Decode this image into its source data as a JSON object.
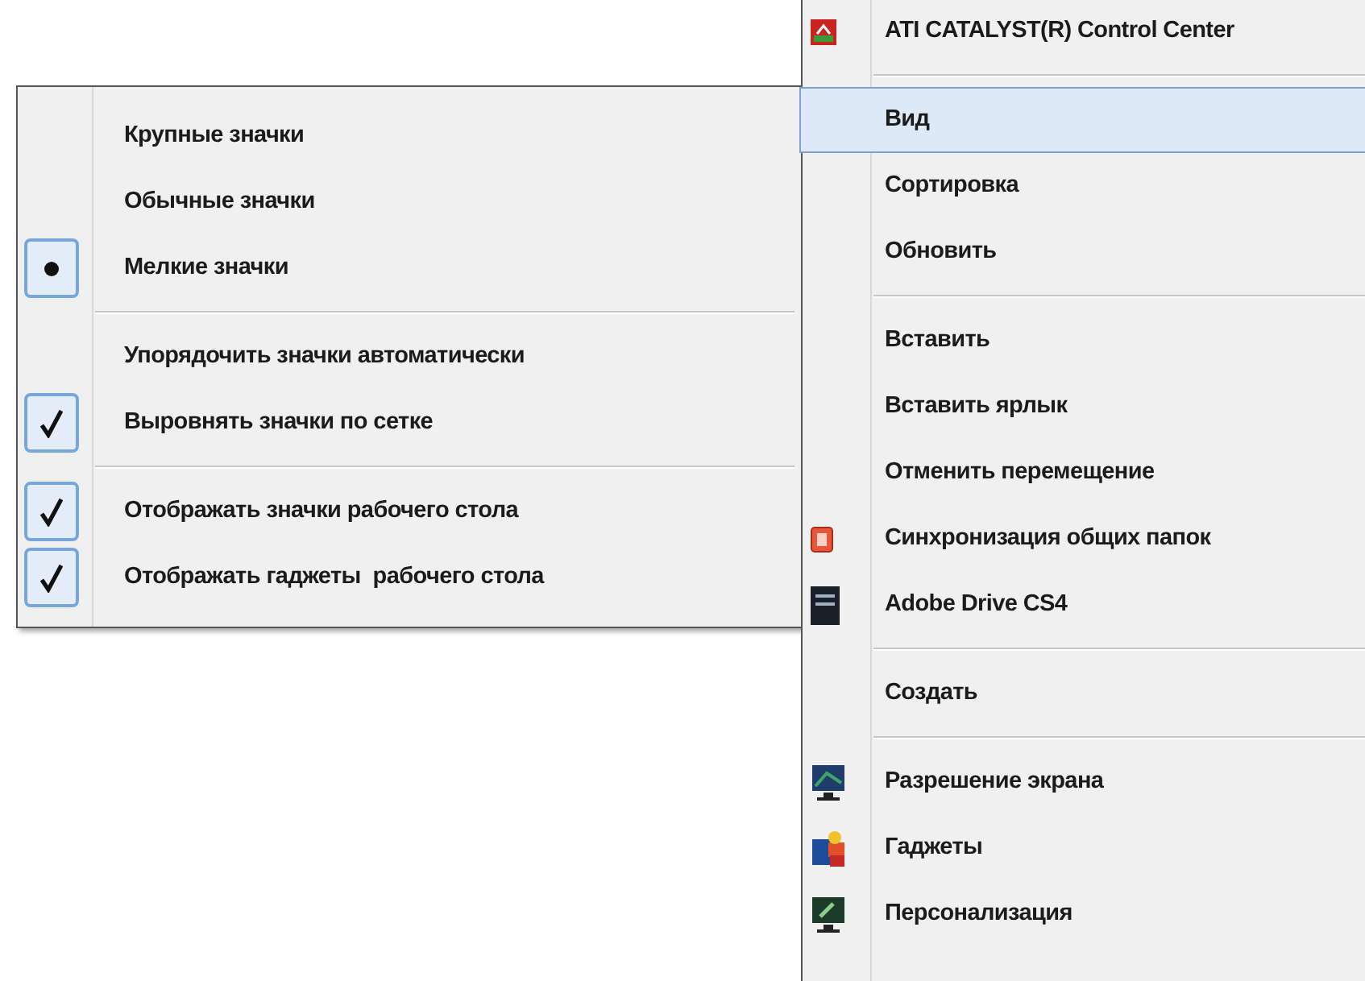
{
  "view_submenu": {
    "groups": [
      {
        "items": [
          {
            "kind": "radio",
            "label": "Крупные значки",
            "selected": false
          },
          {
            "kind": "radio",
            "label": "Обычные значки",
            "selected": false
          },
          {
            "kind": "radio",
            "label": "Мелкие значки",
            "selected": true
          }
        ]
      },
      {
        "items": [
          {
            "kind": "check",
            "label": "Упорядочить значки автоматически",
            "checked": false
          },
          {
            "kind": "check",
            "label": "Выровнять значки по сетке",
            "checked": true
          }
        ]
      },
      {
        "items": [
          {
            "kind": "check",
            "label": "Отображать значки рабочего стола",
            "checked": true
          },
          {
            "kind": "check",
            "label": "Отображать гаджеты  рабочего стола",
            "checked": true
          }
        ]
      }
    ]
  },
  "context_menu": {
    "groups": [
      {
        "items": [
          {
            "kind": "ati",
            "label": "ATI CATALYST(R) Control Center",
            "selected": false
          }
        ]
      },
      {
        "items": [
          {
            "label": "Вид",
            "selected": true
          },
          {
            "label": "Сортировка",
            "selected": false
          },
          {
            "label": "Обновить",
            "selected": false
          }
        ]
      },
      {
        "items": [
          {
            "label": "Вставить",
            "selected": false
          },
          {
            "label": "Вставить ярлык",
            "selected": false
          },
          {
            "label": "Отменить перемещение",
            "selected": false
          },
          {
            "kind": "sync",
            "label": "Синхронизация общих папок",
            "selected": false
          },
          {
            "kind": "drive",
            "label": "Adobe Drive CS4",
            "selected": false
          }
        ]
      },
      {
        "items": [
          {
            "label": "Создать",
            "selected": false
          }
        ]
      },
      {
        "items": [
          {
            "kind": "display",
            "label": "Разрешение экрана",
            "selected": false
          },
          {
            "kind": "gadgets",
            "label": "Гаджеты",
            "selected": false
          },
          {
            "kind": "personalize",
            "label": "Персонализация",
            "selected": false
          }
        ]
      }
    ]
  }
}
